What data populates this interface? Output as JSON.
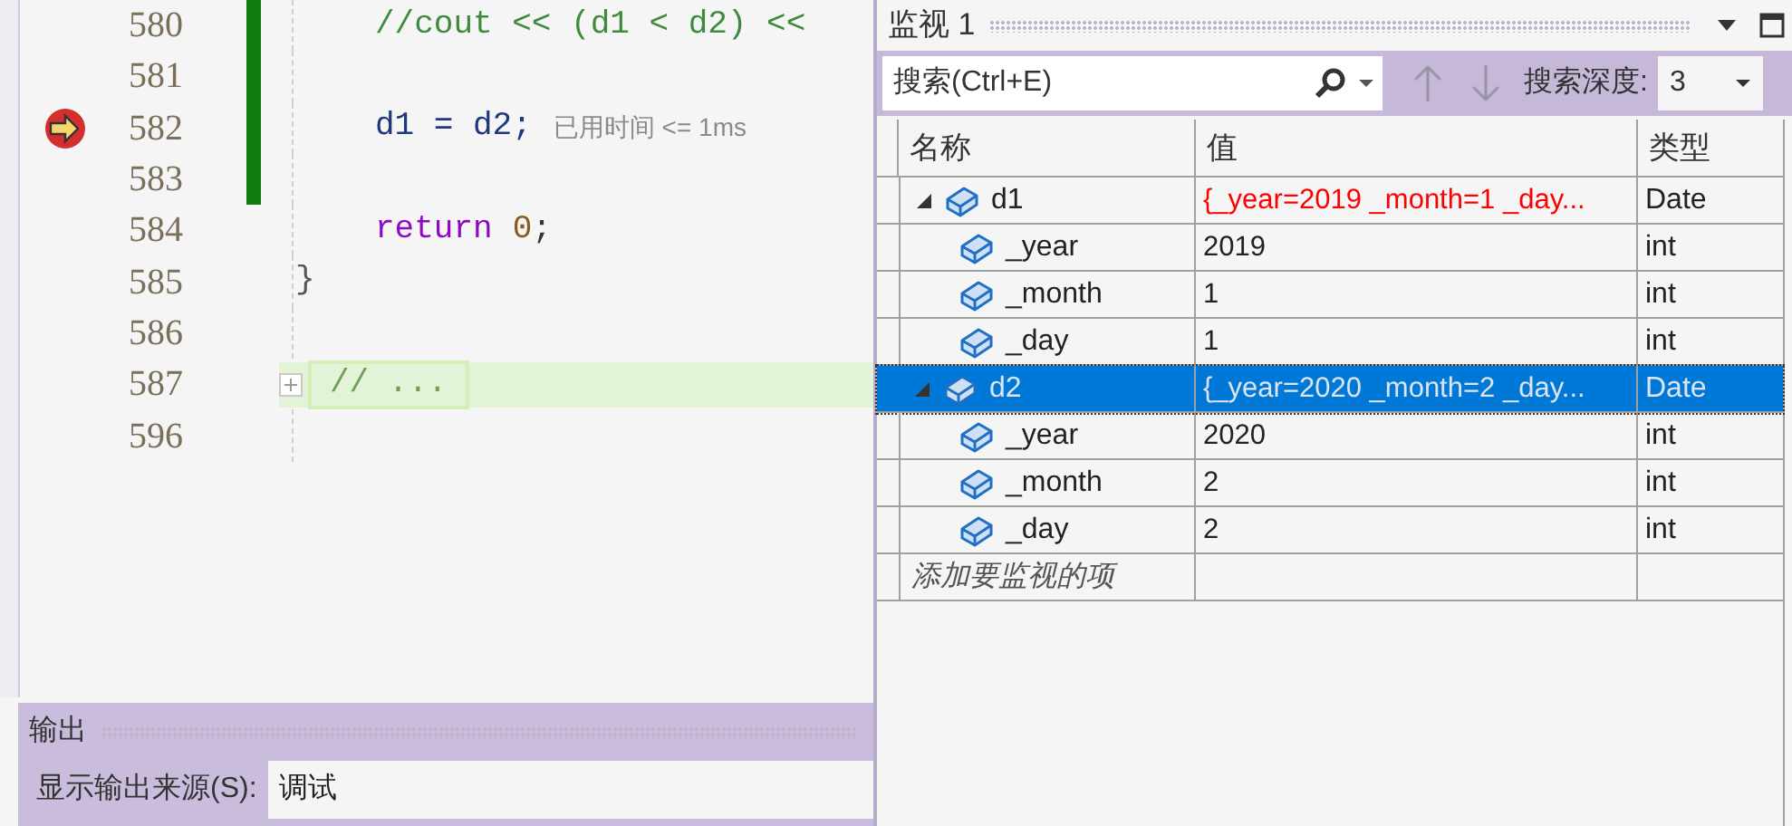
{
  "editor": {
    "lines": [
      {
        "number": "580",
        "changed": true,
        "current": false,
        "collapsed": false,
        "tokens": [
          {
            "kind": "comment",
            "text": "//cout << (d1 < d2) <<"
          }
        ]
      },
      {
        "number": "581",
        "changed": true,
        "current": false,
        "collapsed": false
      },
      {
        "number": "582",
        "changed": true,
        "current": true,
        "collapsed": false,
        "tokens": [
          {
            "kind": "ident",
            "text": "d1 = d2;"
          }
        ],
        "hint": "已用时间 <= 1ms"
      },
      {
        "number": "583",
        "changed": true,
        "current": false,
        "collapsed": false
      },
      {
        "number": "584",
        "changed": false,
        "current": false,
        "collapsed": false,
        "tokens": [
          {
            "kind": "keyword",
            "text": "return"
          },
          {
            "kind": "number",
            "text": "0"
          },
          {
            "kind": "plain",
            "text": ";"
          }
        ]
      },
      {
        "number": "585",
        "changed": false,
        "current": false,
        "collapsed": false,
        "brace": "}"
      },
      {
        "number": "586",
        "changed": false,
        "current": false,
        "collapsed": false
      },
      {
        "number": "587",
        "changed": false,
        "current": false,
        "collapsed": true,
        "tokens": [
          {
            "kind": "comment",
            "text": "// ..."
          }
        ]
      },
      {
        "number": "596",
        "changed": false,
        "current": false,
        "collapsed": false
      }
    ]
  },
  "output": {
    "title": "输出",
    "source_label": "显示输出来源(S):",
    "source_value": "调试"
  },
  "watch": {
    "title": "监视 1",
    "search": {
      "placeholder": "搜索(Ctrl+E)"
    },
    "depth_label": "搜索深度:",
    "depth_value": "3",
    "columns": [
      "名称",
      "值",
      "类型"
    ],
    "rows": [
      {
        "name": "d1",
        "value": "{_year=2019 _month=1 _day...",
        "type": "Date",
        "changed": true,
        "selected": false,
        "expanded": true,
        "children": [
          {
            "name": "_year",
            "value": "2019",
            "type": "int",
            "changed": false,
            "selected": false
          },
          {
            "name": "_month",
            "value": "1",
            "type": "int",
            "changed": false,
            "selected": false
          },
          {
            "name": "_day",
            "value": "1",
            "type": "int",
            "changed": false,
            "selected": false
          }
        ]
      },
      {
        "name": "d2",
        "value": "{_year=2020 _month=2 _day...",
        "type": "Date",
        "changed": false,
        "selected": true,
        "expanded": true,
        "children": [
          {
            "name": "_year",
            "value": "2020",
            "type": "int",
            "changed": false,
            "selected": false
          },
          {
            "name": "_month",
            "value": "2",
            "type": "int",
            "changed": false,
            "selected": false
          },
          {
            "name": "_day",
            "value": "2",
            "type": "int",
            "changed": false,
            "selected": false
          }
        ]
      }
    ],
    "add_placeholder": "添加要监视的项"
  }
}
